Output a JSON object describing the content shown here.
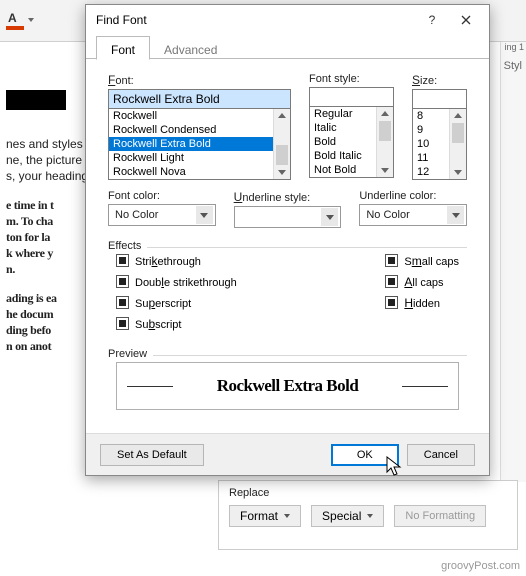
{
  "dialog": {
    "title": "Find Font",
    "tabs": {
      "font": "Font",
      "advanced": "Advanced"
    },
    "labels": {
      "font": "Font:",
      "style": "Font style:",
      "size": "Size:",
      "fontcolor": "Font color:",
      "underline": "Underline style:",
      "ulcolor": "Underline color:",
      "effects": "Effects",
      "preview": "Preview"
    },
    "font_input": "Rockwell Extra Bold",
    "font_list": [
      "Rockwell",
      "Rockwell Condensed",
      "Rockwell Extra Bold",
      "Rockwell Light",
      "Rockwell Nova"
    ],
    "style_list": [
      "Regular",
      "Italic",
      "Bold",
      "Bold Italic",
      "Not Bold"
    ],
    "size_list": [
      "8",
      "9",
      "10",
      "11",
      "12"
    ],
    "fontcolor": "No Color",
    "ulcolor": "No Color",
    "effects_left": [
      {
        "label": "Strikethrough",
        "ul": "k"
      },
      {
        "label": "Double strikethrough",
        "ul": "l"
      },
      {
        "label": "Superscript",
        "ul": "p"
      },
      {
        "label": "Subscript",
        "ul": "b"
      }
    ],
    "effects_right": [
      {
        "label": "Small caps",
        "ul": "m"
      },
      {
        "label": "All caps",
        "ul": "A"
      },
      {
        "label": "Hidden",
        "ul": "H"
      }
    ],
    "preview_text": "Rockwell Extra Bold",
    "buttons": {
      "default": "Set As Default",
      "ok": "OK",
      "cancel": "Cancel"
    }
  },
  "replace_panel": {
    "label": "Replace",
    "format": "Format",
    "special": "Special",
    "noformat": "No Formatting"
  },
  "background": {
    "para1_a": "nes and styles",
    "para1_b": "ne, the picture",
    "para1_c": "s, your heading",
    "para2_a": "e time in t",
    "para2_b": "m. To cha",
    "para2_c": "ton for la",
    "para2_d": "k where y",
    "para2_e": "n.",
    "para3_a": "ading is ea",
    "para3_b": "he docum",
    "para3_c": "ding befo",
    "para3_d": "n on anot"
  },
  "side": {
    "styl": "Styl",
    "ing1": "ing 1"
  },
  "watermark": "groovyPost.com"
}
